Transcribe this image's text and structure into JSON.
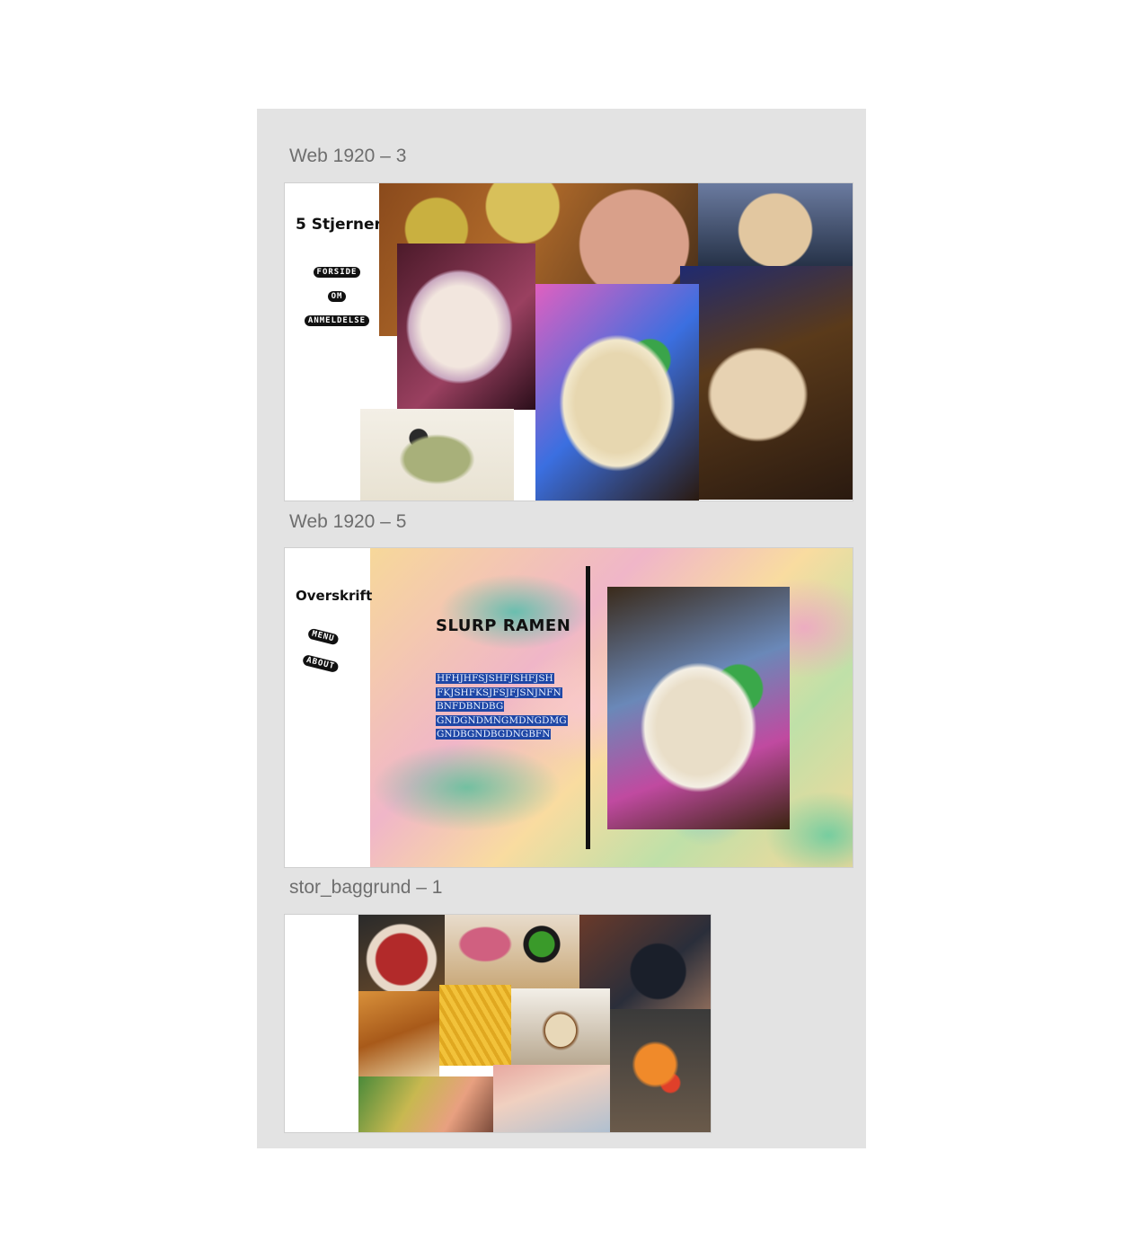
{
  "artboards": [
    {
      "label": "Web 1920 – 3",
      "title": "5 Stjerner",
      "nav": [
        "FORSIDE",
        "OM",
        "ANMELDELSE"
      ]
    },
    {
      "label": "Web 1920 – 5",
      "title": "Overskrift",
      "nav": [
        "MENU",
        "ABOUT"
      ],
      "heading": "SLURP RAMEN",
      "body_lines": [
        "HFHJHFSJSHFJSHFJSH",
        "FKJSHFKSJFSJFJSNJNFN",
        "BNFDBNDBG",
        "GNDGNDMNGMDNGDMG",
        "GNDBGNDBGDNGBFN"
      ]
    },
    {
      "label": "stor_baggrund – 1"
    }
  ],
  "colors": {
    "canvas_bg": "#e3e3e3",
    "label_text": "#6e6e6e",
    "highlight": "#1f47a6"
  }
}
